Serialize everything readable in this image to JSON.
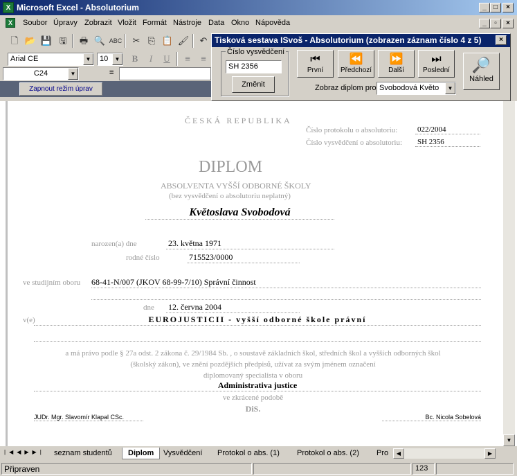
{
  "window": {
    "title": "Microsoft Excel - Absolutorium"
  },
  "menu": [
    "Soubor",
    "Úpravy",
    "Zobrazit",
    "Vložit",
    "Formát",
    "Nástroje",
    "Data",
    "Okno",
    "Nápověda"
  ],
  "format": {
    "font": "Arial CE",
    "size": "10"
  },
  "formula_bar": {
    "cell_ref": "C24",
    "equals": "="
  },
  "edit_mode_button": "Zapnout režim úprav",
  "dialog": {
    "title": "Tisková sestava ISvoš - Absolutorium (zobrazen záznam číslo 4 z 5)",
    "cert_label": "Číslo vysvědčení",
    "cert_value": "SH 2356",
    "change_button": "Změnit",
    "nav": {
      "first": "První",
      "prev": "Předchozí",
      "next": "Další",
      "last": "Poslední"
    },
    "preview": "Náhled",
    "show_diploma_label": "Zobraz diplom pro",
    "show_diploma_value": "Svobodová Květo"
  },
  "diploma": {
    "country": "ČESKÁ REPUBLIKA",
    "protocol_label": "Číslo protokolu o absolutoriu:",
    "protocol_value": "022/2004",
    "cert_label": "Číslo vysvědčení o absolutoriu:",
    "cert_value": "SH 2356",
    "heading": "DIPLOM",
    "subheading": "ABSOLVENTA VYŠŠÍ ODBORNÉ ŠKOLY",
    "note": "(bez vysvědčení o absolutoriu neplatný)",
    "name": "Květoslava Svobodová",
    "born_label": "narozen(a) dne",
    "born_value": "23. května 1971",
    "rc_label": "rodné číslo",
    "rc_value": "715523/0000",
    "field_label": "ve studijním oboru",
    "field_value": "68-41-N/007 (JKOV 68-99-7/10) Správní činnost",
    "date_label": "dne",
    "date_value": "12. června 2004",
    "school_label": "v(e)",
    "school_value": "EUROJUSTICII - vyšší odborné škole právní",
    "law_line1": "a má právo podle § 27a odst. 2 zákona č. 29/1984 Sb. , o soustavě základních škol, středních škol a vyšších odborných škol",
    "law_line2": "(školský zákon), ve znění pozdějších předpisů, užívat za svým jménem označení",
    "law_line3": "diplomovaný specialista v oboru",
    "specialty": "Administrativa justice",
    "abbr_label": "ve zkrácené podobě",
    "abbr_value": "DiS.",
    "sign_left": "JUDr. Mgr. Slavomír Klapal CSc.",
    "sign_right": "Bc. Nicola Sobelová"
  },
  "sheet_tabs": [
    "seznam studentů",
    "Diplom",
    "Vysvědčení",
    "Protokol o abs. (1)",
    "Protokol o abs. (2)",
    "Pro"
  ],
  "active_tab": "Diplom",
  "status": {
    "text": "Připraven",
    "num": "123"
  }
}
